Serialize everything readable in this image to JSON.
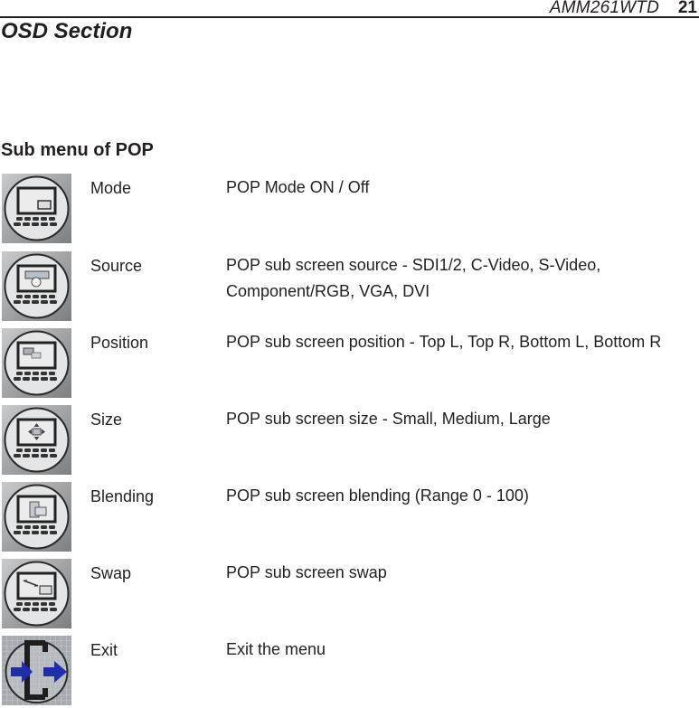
{
  "header": {
    "model": "AMM261WTD",
    "page_number": "21"
  },
  "section_title": "OSD Section",
  "submenu_title": "Sub menu of POP",
  "items": [
    {
      "name": "Mode",
      "description_lines": [
        "POP Mode ON / Off"
      ],
      "icon": "pop-mode-icon"
    },
    {
      "name": "Source",
      "description_lines": [
        "POP sub screen source - SDI1/2, C-Video, S-Video,",
        "Component/RGB, VGA, DVI"
      ],
      "icon": "pop-source-icon"
    },
    {
      "name": "Position",
      "description_lines": [
        "POP sub screen position - Top L, Top R, Bottom L, Bottom R"
      ],
      "icon": "pop-position-icon"
    },
    {
      "name": "Size",
      "description_lines": [
        "POP sub screen size - Small, Medium, Large"
      ],
      "icon": "pop-size-icon"
    },
    {
      "name": "Blending",
      "description_lines": [
        "POP sub screen blending (Range 0 - 100)"
      ],
      "icon": "pop-blending-icon"
    },
    {
      "name": "Swap",
      "description_lines": [
        "POP sub screen swap"
      ],
      "icon": "pop-swap-icon"
    },
    {
      "name": "Exit",
      "description_lines": [
        "Exit the menu"
      ],
      "icon": "exit-icon"
    }
  ],
  "colors": {
    "text": "#231f20",
    "exit_arrow": "#1f2fa8"
  }
}
